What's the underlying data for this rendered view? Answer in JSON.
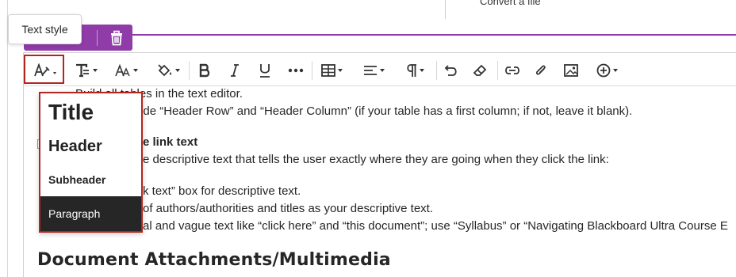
{
  "top": {
    "convert_label": "Convert a file"
  },
  "tooltip": {
    "text": "Text style"
  },
  "toolbar": {
    "items": [
      {
        "name": "text-style-icon"
      },
      {
        "name": "format-icon"
      },
      {
        "name": "font-size-icon"
      },
      {
        "name": "fill-color-icon"
      },
      {
        "name": "bold-icon"
      },
      {
        "name": "italic-icon"
      },
      {
        "name": "underline-icon"
      },
      {
        "name": "more-icon"
      },
      {
        "name": "table-icon"
      },
      {
        "name": "align-icon"
      },
      {
        "name": "paragraph-icon"
      },
      {
        "name": "undo-icon"
      },
      {
        "name": "eraser-icon"
      },
      {
        "name": "link-icon"
      },
      {
        "name": "attachment-icon"
      },
      {
        "name": "image-icon"
      },
      {
        "name": "add-content-icon"
      }
    ]
  },
  "style_menu": {
    "title": "Title",
    "header": "Header",
    "subheader": "Subheader",
    "paragraph": "Paragraph"
  },
  "content": {
    "line1": "Build all tables in the text editor.",
    "line2": "oxes beside “Header Row” and “Header Column” (if your table has a first column; if not, leave it blank).",
    "line3_bold": "e link text",
    "line4": "e descriptive text that tells the user exactly where they are going when they click the link:",
    "line5": "k text” box for descriptive text.",
    "line6": "of authors/authorities and titles as your descriptive text.",
    "line7": "al and vague text like “click here” and “this document”; use “Syllabus” or “Navigating Blackboard Ultra Course E",
    "heading": "Document Attachments/Multimedia"
  },
  "colors": {
    "accent": "#8f3ca8",
    "highlight": "#b3261e",
    "menu_selected_bg": "#262626"
  }
}
